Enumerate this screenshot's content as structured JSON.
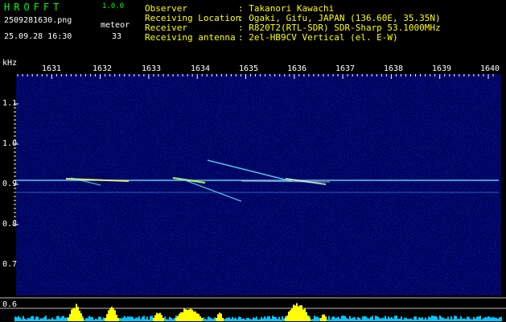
{
  "header": {
    "logo": "HROFFT",
    "version": "1.0.0",
    "filename": "2509281630.png",
    "datetime": "25.09.28 16:30",
    "meteor_label": "meteor",
    "meteor_count": "33"
  },
  "info": [
    {
      "key": "Observer",
      "value": ": Takanori Kawachi"
    },
    {
      "key": "Receiving Location",
      "value": ": Ogaki, Gifu, JAPAN (136.60E, 35.35N)"
    },
    {
      "key": "Receiver",
      "value": ": R820T2(RTL-SDR) SDR-Sharp 53.1000MHz"
    },
    {
      "key": "Receiving antenna",
      "value": ": 2el-HB9CV Vertical (el. E-W)"
    }
  ],
  "axes": {
    "y_unit": "kHz",
    "x_ticks": [
      "1631",
      "1632",
      "1633",
      "1634",
      "1635",
      "1636",
      "1637",
      "1638",
      "1639",
      "1640"
    ],
    "y_ticks": [
      "1.1",
      "1.0",
      "0.9",
      "0.8",
      "0.7",
      "0.6"
    ]
  },
  "colors": {
    "background": "#000000",
    "header_text": "#ffffff",
    "info_text": "#ffff00",
    "logo": "#00ff00",
    "waterfall_bg": "#00005a",
    "carrier": "#66ddff",
    "level_bars": "#00c8ff",
    "level_peaks": "#ffff00"
  }
}
